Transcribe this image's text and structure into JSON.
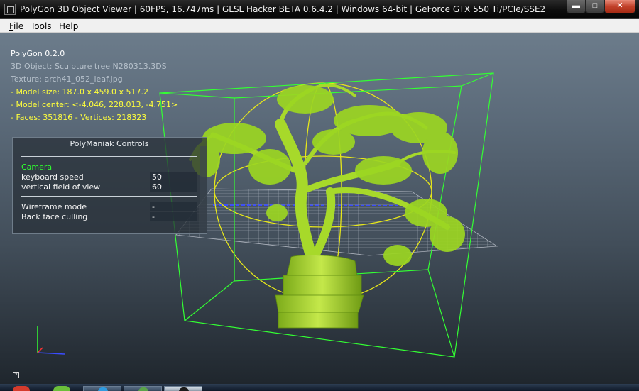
{
  "window": {
    "title": "PolyGon 3D Object Viewer | 60FPS, 16.747ms | GLSL Hacker BETA 0.6.4.2 | Windows 64-bit | GeForce GTX 550 Ti/PCIe/SSE2",
    "icon": "application-icon",
    "controls": {
      "minimize": "minimize-icon",
      "maximize": "maximize-icon",
      "close": "close-icon"
    }
  },
  "menu": {
    "file": "File",
    "tools": "Tools",
    "help": "Help"
  },
  "info": {
    "app_name": "PolyGon 0.2.0",
    "object": "3D Object: Sculpture tree N280313.3DS",
    "texture": "Texture: arch41_052_leaf.jpg",
    "model_size": "- Model size:  187.0 x 459.0 x 517.2",
    "model_center": "- Model center:  <-4.046, 228.013, -4.751>",
    "faces_vertices": "- Faces: 351816 - Vertices: 218323"
  },
  "controls_panel": {
    "title": "PolyManiak Controls",
    "camera_header": "Camera",
    "keyboard_speed_label": "keyboard speed",
    "keyboard_speed_value": "50",
    "fov_label": "vertical field of view",
    "fov_value": "60",
    "wireframe_label": "Wireframe mode",
    "wireframe_value": "-",
    "backface_label": "Back face culling",
    "backface_value": "-"
  },
  "colors": {
    "bounding_box": "#33ff33",
    "bounding_sphere": "#e7e71a",
    "grid": "#d9dde6",
    "tree_foliage": "#9cd622",
    "info_highlight": "#ffff3c",
    "camera_header": "#2fff2f"
  },
  "taskbar": {
    "items": [
      "start-button-icon",
      "chrome-icon",
      "ie-icon",
      "chrome-window-icon",
      "polygon-app-icon"
    ]
  }
}
